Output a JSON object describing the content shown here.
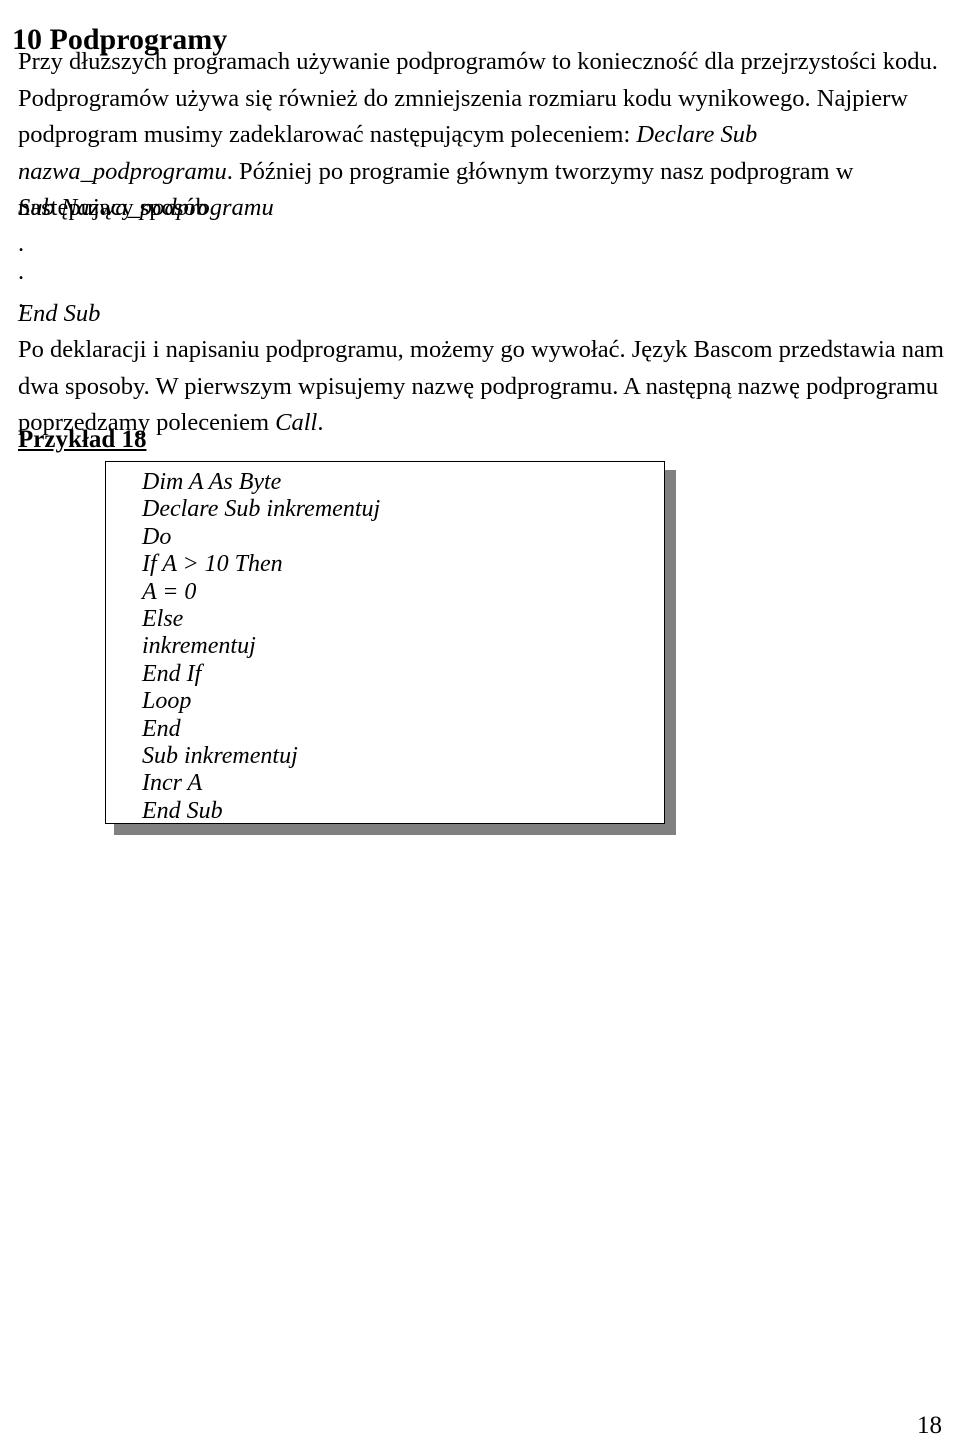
{
  "document": {
    "chapter_heading": "10 Podprogramy",
    "paragraph_1_parts": {
      "text_a": "Przy dłuższych programach używanie podprogramów to konieczność dla przejrzystości kodu. Podprogramów używa się również do zmniejszenia rozmiaru kodu wynikowego. Najpierw podprogram musimy zadeklarować następującym poleceniem: ",
      "italic_b": "Declare Sub nazwa_podprogramu",
      "text_c": ". Później po programie głównym tworzymy nasz podprogram w następujący sposób"
    },
    "sub_signature": "Sub Nazwa_podprogramu",
    "dots": [
      ".",
      ".",
      "."
    ],
    "end_sub": "End Sub",
    "paragraph_2_parts": {
      "text_a": "Po deklaracji i napisaniu podprogramu, możemy go wywołać. Język Bascom przedstawia  nam dwa sposoby. W pierwszym wpisujemy nazwę podprogramu. A następną nazwę podprogramu poprzedzamy poleceniem ",
      "italic_b": "Call",
      "text_c": "."
    },
    "example_heading": "Przykład 18",
    "code_listing": [
      "Dim A As Byte",
      "Declare Sub inkrementuj",
      "Do",
      "If A > 10 Then",
      "A = 0",
      "Else",
      "inkrementuj",
      "End If",
      "Loop",
      "End",
      "Sub inkrementuj",
      "Incr A",
      "End Sub"
    ],
    "page_number": "18",
    "colors": {
      "text": "#000000",
      "box_border": "#000000",
      "box_shadow": "#808080",
      "page_background": "#ffffff"
    }
  }
}
